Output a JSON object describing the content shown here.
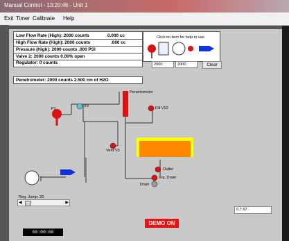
{
  "window": {
    "title": "Manual Control - 13:20:46 - Unit 1"
  },
  "menu": [
    {
      "label": "Exit"
    },
    {
      "label": "Timer"
    },
    {
      "label": "Calibrate"
    },
    {
      "label": "Help"
    }
  ],
  "readings": {
    "low_flow": {
      "label": "Low Flow Rate   (High):  2000 counts",
      "value": "0.000 cc"
    },
    "high_flow": {
      "label": "High Flow Rate   (High):  2000 counts",
      "value": ".000 cc"
    },
    "pressure": {
      "label": "Pressure (High):  2000 counts        .000 PSI"
    },
    "valve2": {
      "label": "Valve 2:  2000 counts   0.00% open"
    },
    "regulator": {
      "label": "Regulator:          0 counts"
    }
  },
  "penetrometer_reading": "Penetrometer:  2000 counts      2.500 cm of H2O",
  "help_panel": {
    "hint": "Click on item for help in use",
    "field1": "2000",
    "field2": "2000",
    "clear_label": "Clear"
  },
  "diagram": {
    "p1": "P1",
    "v9": "V9",
    "penetrometer": "Penetrometer",
    "fill_v10": "Fill V10",
    "vent_v3": "Vent V3",
    "outlet": "Outlet",
    "liq_drain": "Liq. Drain",
    "drain": "Drain"
  },
  "reg_jump": "Reg. Jump: 20",
  "readout": "0.7.67",
  "demo": "DEMO ON",
  "timer": "00:00:00",
  "colors": {
    "valve_red": "#dd1111",
    "arrow_blue": "#1133dd",
    "tank_orange": "#ff8800",
    "tank_rim": "#ffff00",
    "v9_cyan": "#55ccdd"
  }
}
